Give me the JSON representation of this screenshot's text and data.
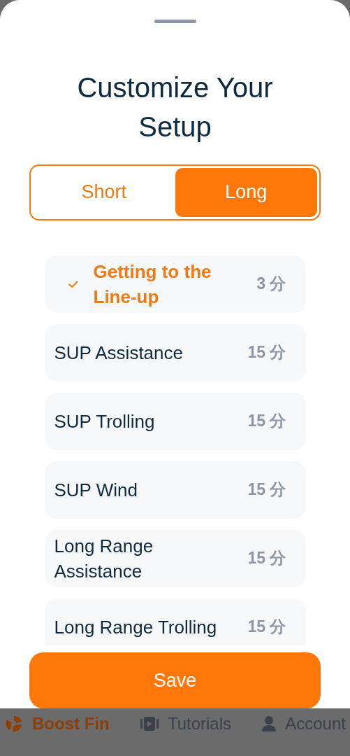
{
  "title": "Customize Your Setup",
  "toggle": [
    {
      "label": "Short",
      "selected": false
    },
    {
      "label": "Long",
      "selected": true
    }
  ],
  "items": [
    {
      "name": "Getting to the Line-up",
      "duration": "3 分",
      "selected": true
    },
    {
      "name": "SUP Assistance",
      "duration": "15 分",
      "selected": false
    },
    {
      "name": "SUP Trolling",
      "duration": "15 分",
      "selected": false
    },
    {
      "name": "SUP Wind",
      "duration": "15 分",
      "selected": false
    },
    {
      "name": "Long Range Assistance",
      "duration": "15 分",
      "selected": false
    },
    {
      "name": "Long Range Trolling",
      "duration": "15 分",
      "selected": false
    }
  ],
  "save_button": "Save",
  "nav": [
    {
      "label": "Boost Fin",
      "kind": "logo",
      "selected": true
    },
    {
      "label": "Tutorials",
      "kind": "video",
      "selected": false
    },
    {
      "label": "Account",
      "kind": "person",
      "selected": false
    }
  ]
}
